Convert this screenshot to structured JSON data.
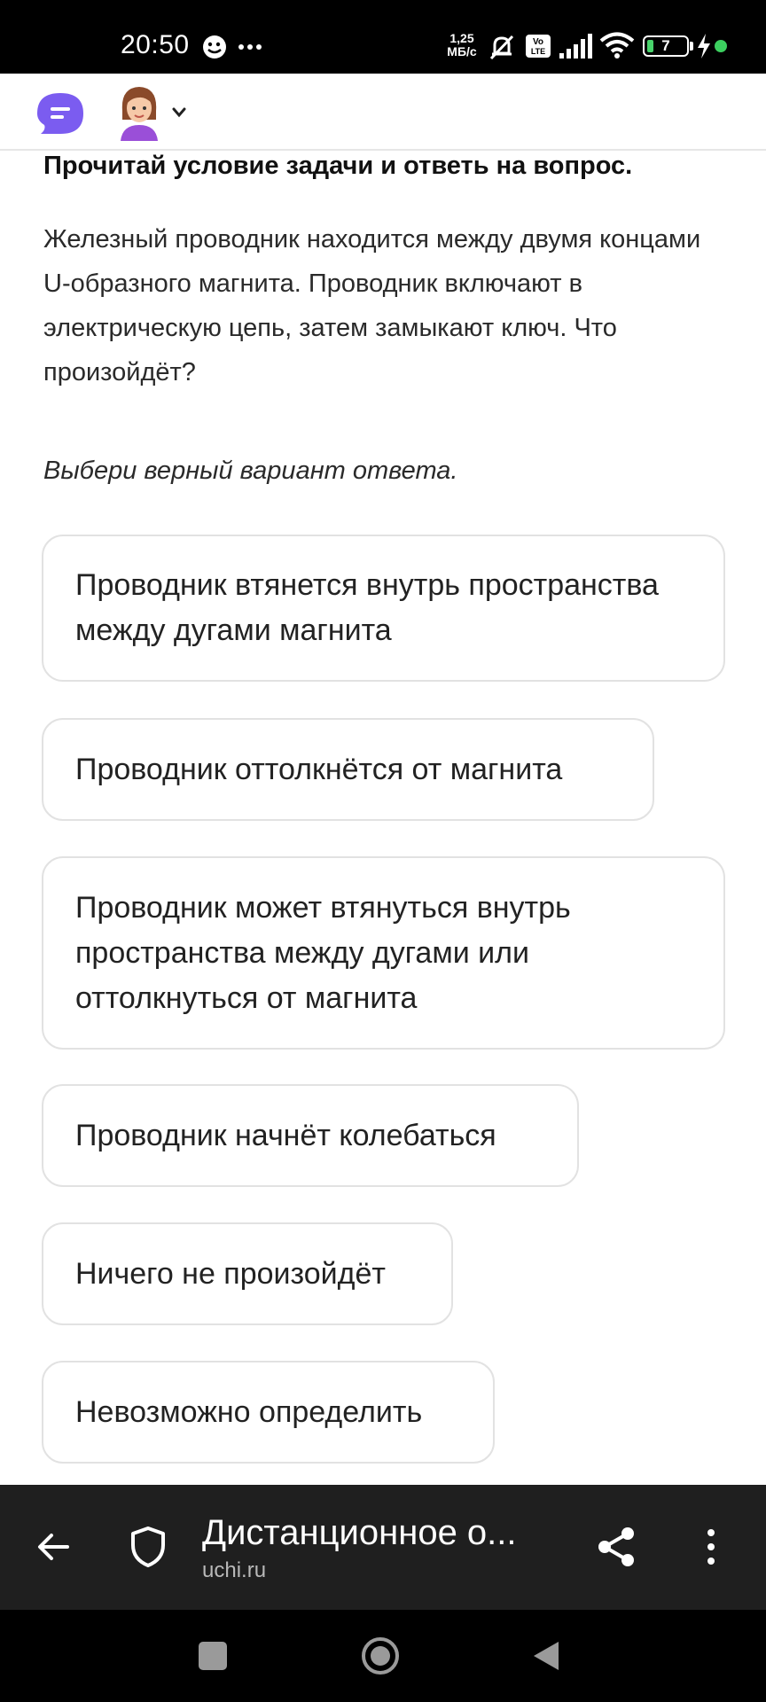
{
  "status_bar": {
    "time": "20:50",
    "speed_value": "1,25",
    "speed_unit": "МБ/с",
    "battery": "7",
    "icons": [
      "face-emoji-icon",
      "more-dots-icon",
      "mute-icon",
      "volte-icon",
      "signal-icon",
      "wifi-icon",
      "battery-icon",
      "charging-icon"
    ]
  },
  "app_header": {
    "icons": [
      "chat-bubble-icon",
      "avatar",
      "chevron-down-icon"
    ]
  },
  "task": {
    "title": "Прочитай условие задачи и ответь на вопрос.",
    "text": "Железный проводник находится между двумя концами U-образного магнита. Проводник включают в электрическую цепь, затем замыкают ключ. Что произойдёт?",
    "instruction": "Выбери верный вариант ответа."
  },
  "options": [
    "Проводник втянется внутрь пространства между дугами магнита",
    "Проводник оттолкнётся от магнита",
    "Проводник может втянуться внутрь пространства между дугами или оттолкнуться от магнита",
    "Проводник начнёт колебаться",
    "Ничего не произойдёт",
    "Невозможно определить"
  ],
  "browser_bar": {
    "title": "Дистанционное о...",
    "url": "uchi.ru",
    "icons": [
      "back-arrow-icon",
      "shield-icon",
      "share-icon",
      "more-vert-icon"
    ]
  },
  "nav_bar": {
    "icons": [
      "recents-square-icon",
      "home-circle-icon",
      "back-triangle-icon"
    ]
  },
  "colors": {
    "accent_purple": "#7b5cf0",
    "status_bar_bg": "#000000",
    "browser_bar_bg": "#1f1f1f",
    "charging_green": "#3ccf5f"
  }
}
